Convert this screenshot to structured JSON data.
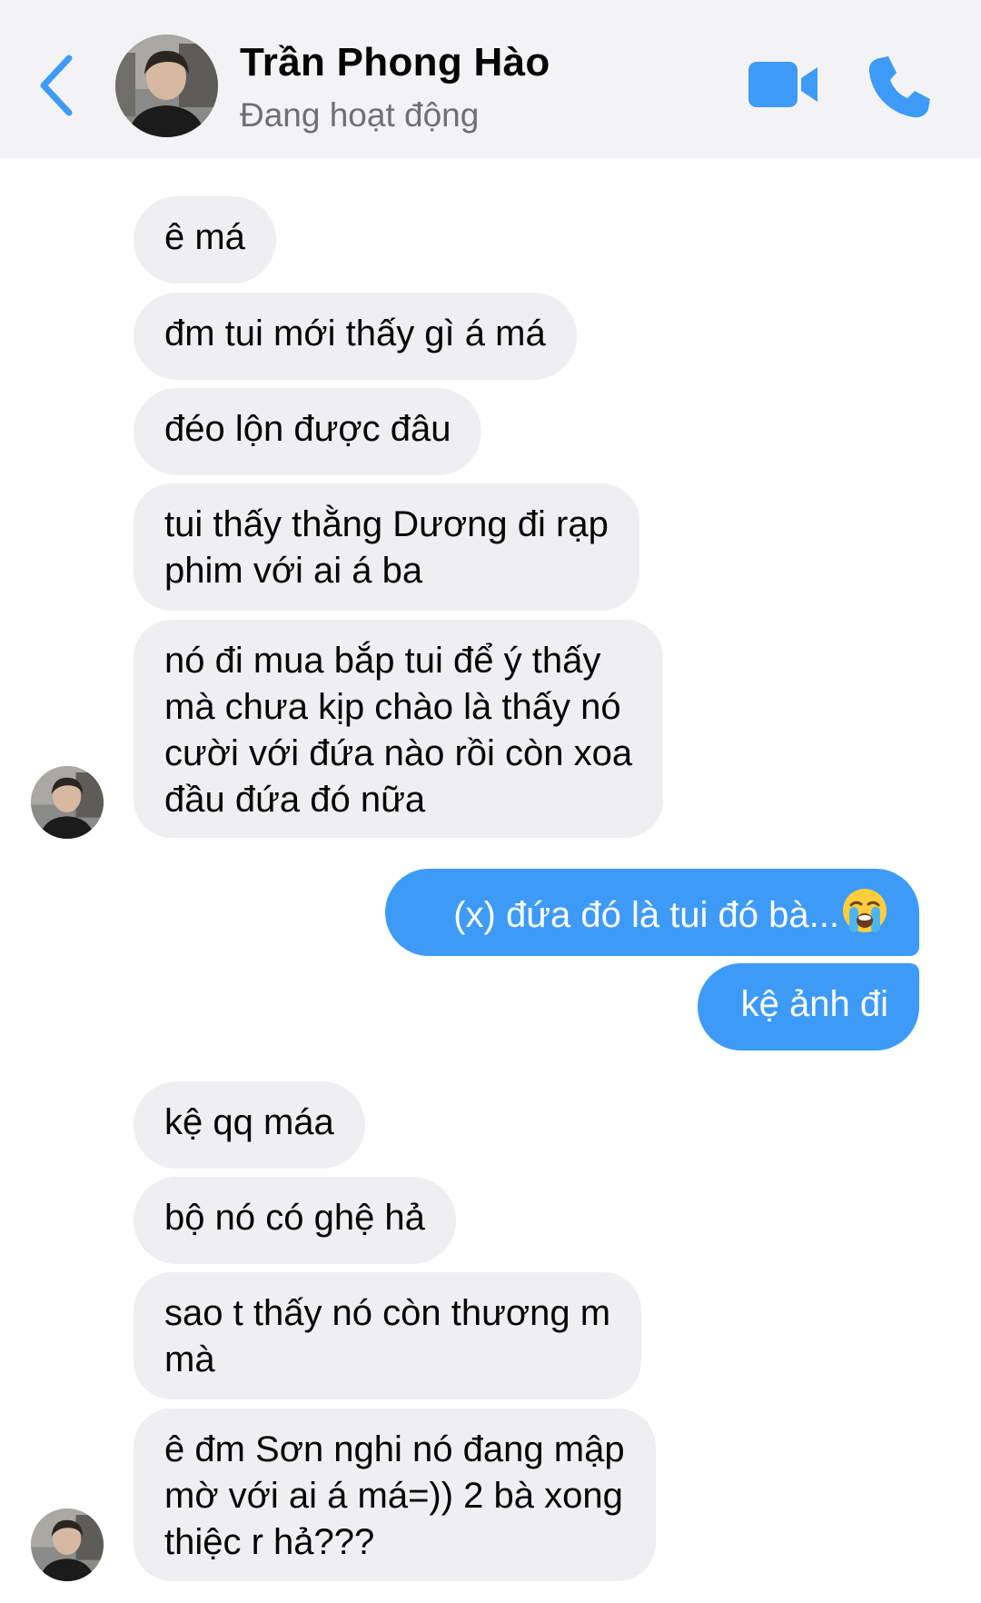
{
  "header": {
    "contact_name": "Trần Phong Hào",
    "status": "Đang hoạt động",
    "accent_color": "#3d9bf7"
  },
  "messages": [
    {
      "direction": "incoming",
      "text": "ê má"
    },
    {
      "direction": "incoming",
      "text": "đm tui mới thấy gì á má"
    },
    {
      "direction": "incoming",
      "text": "đéo lộn được đâu"
    },
    {
      "direction": "incoming",
      "lines": [
        "tui thấy thằng Dương đi rạp",
        "phim với ai á ba"
      ]
    },
    {
      "direction": "incoming",
      "lines": [
        "nó đi mua bắp tui để ý thấy",
        "mà chưa kịp chào là thấy nó",
        "cười với đứa nào rồi còn xoa",
        "đầu đứa đó nữa"
      ]
    },
    {
      "direction": "outgoing",
      "text": "(x) đứa đó là tui đó bà...",
      "emoji": "loudly-crying-face-emoji"
    },
    {
      "direction": "outgoing",
      "text": "kệ ảnh đi"
    },
    {
      "direction": "incoming",
      "text": "kệ qq máa"
    },
    {
      "direction": "incoming",
      "text": "bộ nó có ghệ hả"
    },
    {
      "direction": "incoming",
      "lines": [
        "sao t thấy nó còn thương m",
        "mà"
      ]
    },
    {
      "direction": "incoming",
      "lines": [
        "ê đm Sơn nghi nó đang mập",
        "mờ với ai á má=)) 2 bà xong",
        "thiệc r hả???"
      ]
    }
  ],
  "icons": {
    "back": "chevron-left-icon",
    "video": "video-camera-icon",
    "call": "phone-icon"
  }
}
